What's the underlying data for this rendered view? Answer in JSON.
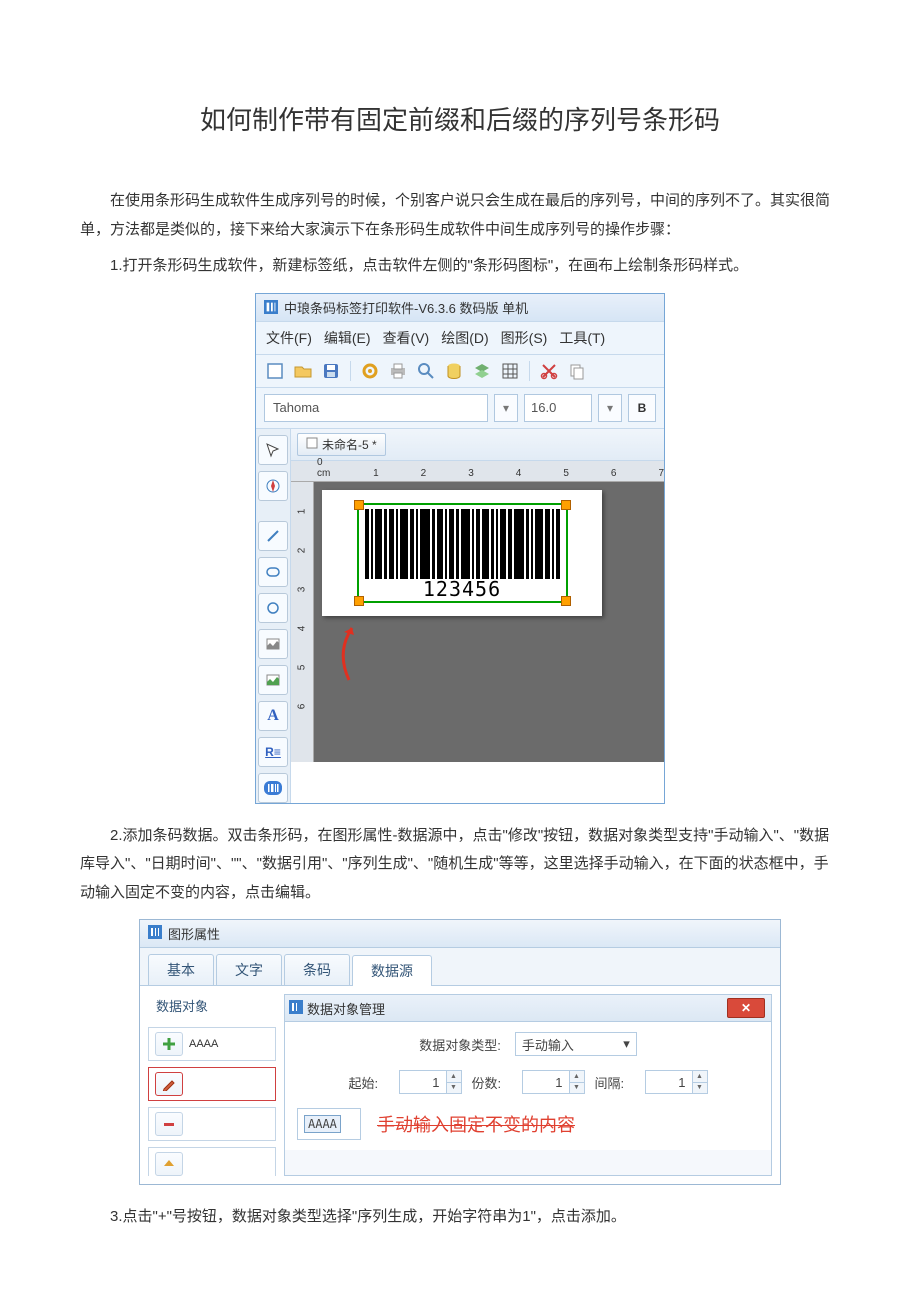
{
  "doc": {
    "title": "如何制作带有固定前缀和后缀的序列号条形码",
    "p1": "在使用条形码生成软件生成序列号的时候，个别客户说只会生成在最后的序列号，中间的序列不了。其实很简单，方法都是类似的，接下来给大家演示下在条形码生成软件中间生成序列号的操作步骤：",
    "p2": "1.打开条形码生成软件，新建标签纸，点击软件左侧的\"条形码图标\"，在画布上绘制条形码样式。",
    "p3": "2.添加条码数据。双击条形码，在图形属性-数据源中，点击\"修改\"按钮，数据对象类型支持\"手动输入\"、\"数据库导入\"、\"日期时间\"、\"\"、\"数据引用\"、\"序列生成\"、\"随机生成\"等等，这里选择手动输入，在下面的状态框中，手动输入固定不变的内容，点击编辑。",
    "p4": "3.点击\"+\"号按钮，数据对象类型选择\"序列生成，开始字符串为1\"，点击添加。"
  },
  "app1": {
    "title": "中琅条码标签打印软件-V6.3.6 数码版 单机",
    "menus": {
      "file": "文件(F)",
      "edit": "编辑(E)",
      "view": "查看(V)",
      "draw": "绘图(D)",
      "graphic": "图形(S)",
      "tools": "工具(T)"
    },
    "font_name": "Tahoma",
    "font_size": "16.0",
    "bold": "B",
    "tab_label": "未命名-5 *",
    "ruler_h": [
      "0 cm",
      "1",
      "2",
      "3",
      "4",
      "5",
      "6",
      "7"
    ],
    "ruler_v": [
      "1",
      "2",
      "3",
      "4",
      "5",
      "6"
    ],
    "barcode_text": "123456"
  },
  "app2": {
    "dialog_title": "图形属性",
    "tabs": {
      "basic": "基本",
      "text": "文字",
      "barcode": "条码",
      "data": "数据源"
    },
    "left_title": "数据对象",
    "obj_val": "AAAA",
    "mgr_title": "数据对象管理",
    "type_label": "数据对象类型:",
    "type_value": "手动输入",
    "start_label": "起始:",
    "count_label": "份数:",
    "gap_label": "间隔:",
    "start_val": "1",
    "count_val": "1",
    "gap_val": "1",
    "input_val": "AAAA",
    "red_note": "手动输入固定不变的内容"
  }
}
